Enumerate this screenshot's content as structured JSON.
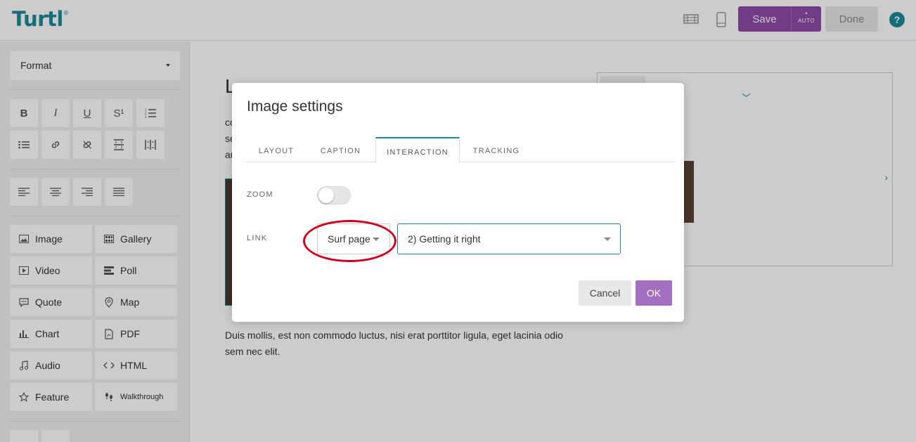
{
  "app": {
    "logo": "Turtl",
    "logo_mark": "®"
  },
  "topbar": {
    "desktop_view_icon": "desktop-view-icon",
    "mobile_view_icon": "mobile-view-icon",
    "save_label": "Save",
    "auto_dot": "•",
    "auto_label": "AUTO",
    "done_label": "Done",
    "help_label": "?",
    "accent_color": "#8e4aa8",
    "brand_color": "#1b8a99"
  },
  "sidebar": {
    "format_label": "Format",
    "format_buttons": [
      {
        "name": "bold",
        "label": "B"
      },
      {
        "name": "italic",
        "label": "I"
      },
      {
        "name": "underline",
        "label": "U"
      },
      {
        "name": "superscript",
        "label": "S¹"
      },
      {
        "name": "ordered-list",
        "label": ""
      },
      {
        "name": "unordered-list",
        "label": ""
      },
      {
        "name": "link",
        "label": ""
      },
      {
        "name": "unlink",
        "label": ""
      },
      {
        "name": "vertical-spacing",
        "label": ""
      },
      {
        "name": "horizontal-spacing",
        "label": ""
      }
    ],
    "align_buttons": [
      "align-left",
      "align-center",
      "align-right",
      "align-justify"
    ],
    "widgets": [
      {
        "name": "image",
        "label": "Image",
        "icon": "image-icon"
      },
      {
        "name": "gallery",
        "label": "Gallery",
        "icon": "gallery-icon"
      },
      {
        "name": "video",
        "label": "Video",
        "icon": "video-icon"
      },
      {
        "name": "poll",
        "label": "Poll",
        "icon": "poll-icon"
      },
      {
        "name": "quote",
        "label": "Quote",
        "icon": "quote-icon"
      },
      {
        "name": "map",
        "label": "Map",
        "icon": "map-pin-icon"
      },
      {
        "name": "chart",
        "label": "Chart",
        "icon": "chart-icon"
      },
      {
        "name": "pdf",
        "label": "PDF",
        "icon": "pdf-icon"
      },
      {
        "name": "audio",
        "label": "Audio",
        "icon": "music-note-icon"
      },
      {
        "name": "html",
        "label": "HTML",
        "icon": "code-icon"
      },
      {
        "name": "feature",
        "label": "Feature",
        "icon": "star-icon"
      },
      {
        "name": "walkthrough",
        "label": "Walkthrough",
        "icon": "footprints-icon"
      }
    ]
  },
  "content": {
    "title_fragment": "L",
    "text_fragments": [
      "co",
      "se",
      "au"
    ],
    "paragraph": "Duis mollis, est non commodo luctus, nisi erat porttitor ligula, eget lacinia odio sem nec elit."
  },
  "modal": {
    "title": "Image settings",
    "tabs": [
      {
        "label": "LAYOUT",
        "active": false
      },
      {
        "label": "CAPTION",
        "active": false
      },
      {
        "label": "INTERACTION",
        "active": true
      },
      {
        "label": "TRACKING",
        "active": false
      }
    ],
    "zoom_label": "ZOOM",
    "zoom_enabled": false,
    "link_label": "LINK",
    "link_type_value": "Surf page",
    "link_page_value": "2) Getting it right",
    "cancel_label": "Cancel",
    "ok_label": "OK",
    "annotation_color": "#d0021b"
  }
}
